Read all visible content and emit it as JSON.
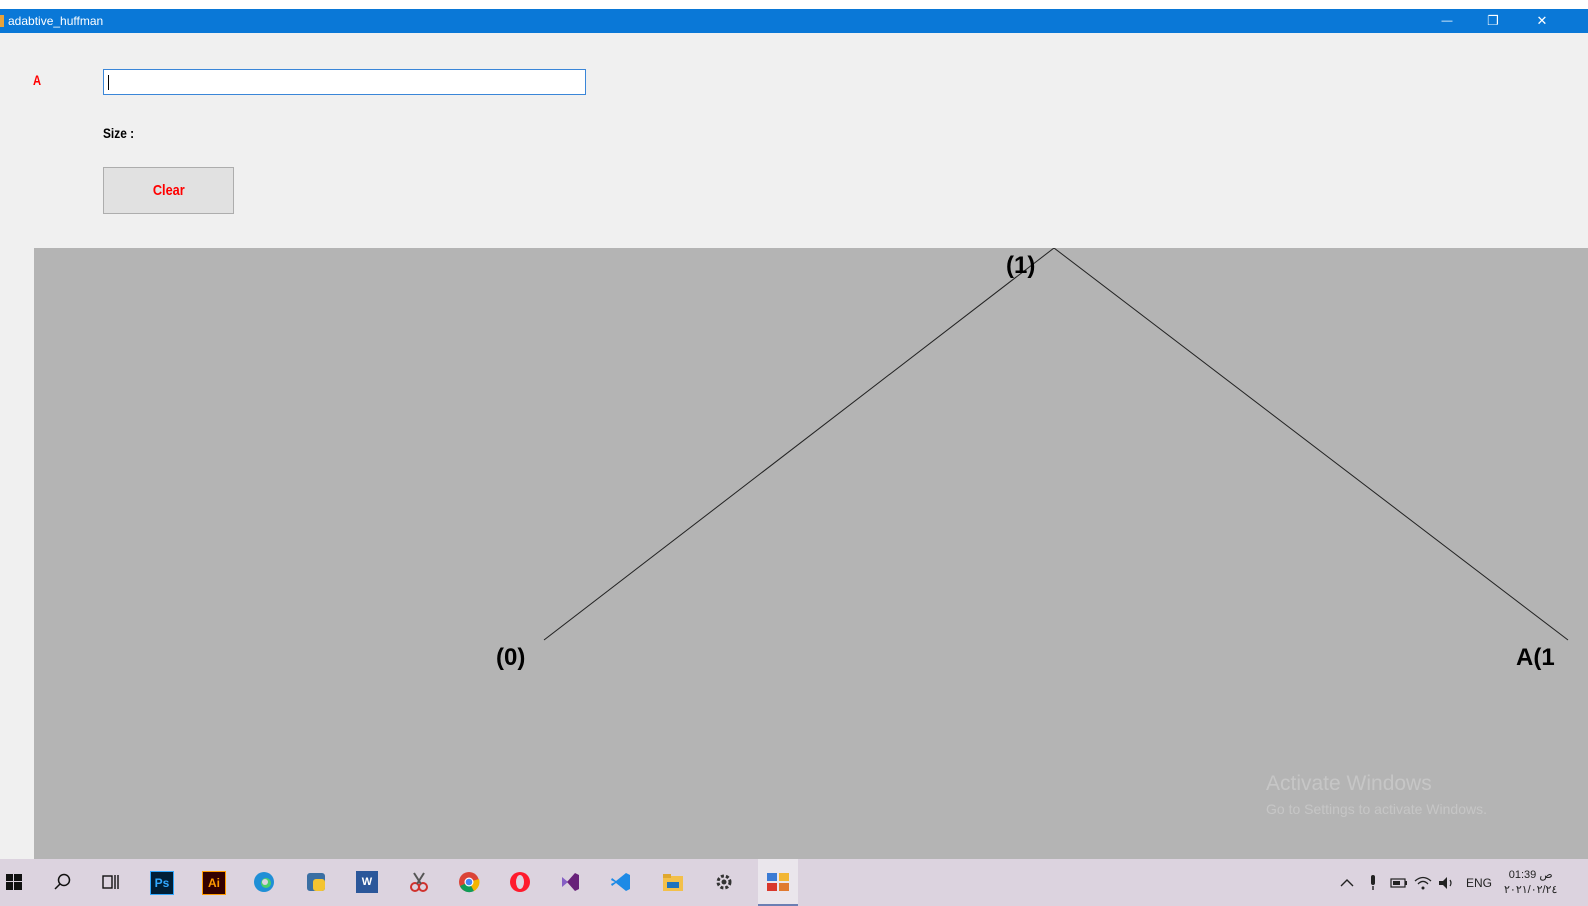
{
  "window": {
    "title": "adabtive_huffman",
    "minimize_glyph": "—",
    "maximize_glyph": "❐",
    "close_glyph": "✕"
  },
  "form": {
    "char_label": "A",
    "input_value": "",
    "size_label": "Size :",
    "clear_label": "Clear"
  },
  "tree": {
    "root_label": "(1)",
    "left_label": "(0)",
    "right_label": "A(1"
  },
  "watermark": {
    "title": "Activate Windows",
    "subtitle": "Go to Settings to activate Windows."
  },
  "taskbar": {
    "photoshop_text": "Ps",
    "illustrator_text": "Ai",
    "word_text": "W",
    "language": "ENG",
    "time": "01:39 ص",
    "date": "٢٠٢١/٠٢/٢٤"
  }
}
